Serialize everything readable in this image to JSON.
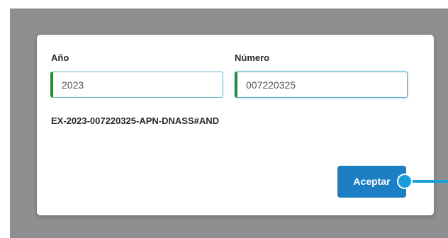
{
  "dialog": {
    "year": {
      "label": "Año",
      "value": "2023"
    },
    "number": {
      "label": "Número",
      "value": "007220325"
    },
    "reference": "EX-2023-007220325-APN-DNASS#AND",
    "accept_label": "Aceptar"
  },
  "colors": {
    "accent_button": "#1e7ec3",
    "field_marker": "#2c8a3c",
    "pointer": "#1b9ed8"
  }
}
